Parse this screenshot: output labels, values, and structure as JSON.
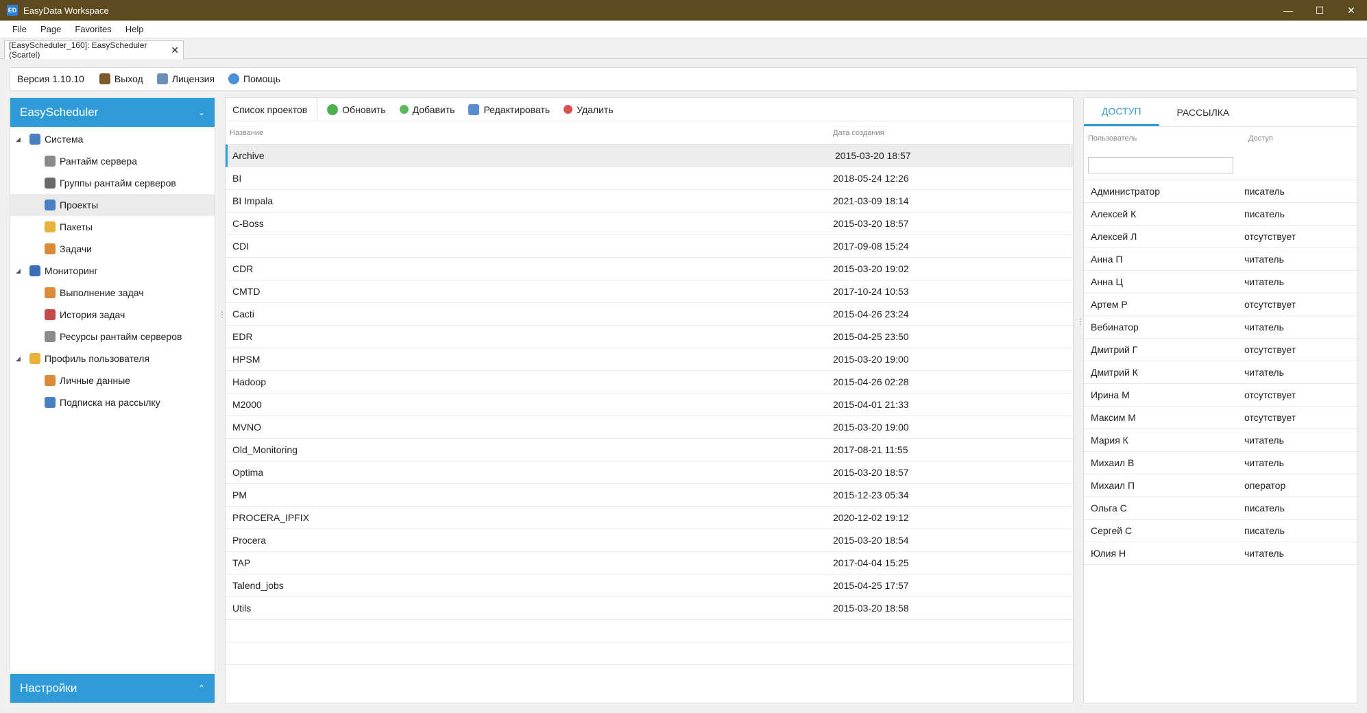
{
  "window": {
    "title": "EasyData Workspace",
    "app_icon_text": "ED"
  },
  "menu": [
    "File",
    "Page",
    "Favorites",
    "Help"
  ],
  "doc_tab": {
    "label": "[EasyScheduler_160]: EasyScheduler (Scartel)",
    "close": "✕"
  },
  "topbar": {
    "version": "Версия 1.10.10",
    "exit": "Выход",
    "license": "Лицензия",
    "help": "Помощь"
  },
  "sidebar": {
    "title": "EasyScheduler",
    "footer": "Настройки",
    "items": [
      {
        "label": "Система",
        "level": 0,
        "icon": "system-icon",
        "color": "#4a7fc1"
      },
      {
        "label": "Рантайм сервера",
        "level": 1,
        "icon": "server-icon",
        "color": "#8a8a8a"
      },
      {
        "label": "Группы рантайм серверов",
        "level": 1,
        "icon": "server-group-icon",
        "color": "#6a6a6a"
      },
      {
        "label": "Проекты",
        "level": 1,
        "icon": "projects-icon",
        "color": "#4a7fc1"
      },
      {
        "label": "Пакеты",
        "level": 1,
        "icon": "package-icon",
        "color": "#e6b23a"
      },
      {
        "label": "Задачи",
        "level": 1,
        "icon": "tasks-icon",
        "color": "#d98b3a"
      },
      {
        "label": "Мониторинг",
        "level": 0,
        "icon": "monitor-icon",
        "color": "#3a6fb8"
      },
      {
        "label": "Выполнение задач",
        "level": 1,
        "icon": "task-run-icon",
        "color": "#d98b3a"
      },
      {
        "label": "История задач",
        "level": 1,
        "icon": "history-chart-icon",
        "color": "#c44b4b"
      },
      {
        "label": "Ресурсы рантайм серверов",
        "level": 1,
        "icon": "resources-icon",
        "color": "#8a8a8a"
      },
      {
        "label": "Профиль пользователя",
        "level": 0,
        "icon": "profile-icon",
        "color": "#e6b23a"
      },
      {
        "label": "Личные данные",
        "level": 1,
        "icon": "person-icon",
        "color": "#d98b3a"
      },
      {
        "label": "Подписка на рассылку",
        "level": 1,
        "icon": "subscription-icon",
        "color": "#4a7fc1"
      }
    ]
  },
  "projects": {
    "toolbar": {
      "title": "Список проектов",
      "refresh": "Обновить",
      "add": "Добавить",
      "edit": "Редактировать",
      "delete": "Удалить"
    },
    "columns": [
      "Название",
      "Дата создания"
    ],
    "rows": [
      [
        "Archive",
        "2015-03-20 18:57"
      ],
      [
        "BI",
        "2018-05-24 12:26"
      ],
      [
        "BI Impala",
        "2021-03-09 18:14"
      ],
      [
        "C-Boss",
        "2015-03-20 18:57"
      ],
      [
        "CDI",
        "2017-09-08 15:24"
      ],
      [
        "CDR",
        "2015-03-20 19:02"
      ],
      [
        "CMTD",
        "2017-10-24 10:53"
      ],
      [
        "Cacti",
        "2015-04-26 23:24"
      ],
      [
        "EDR",
        "2015-04-25 23:50"
      ],
      [
        "HPSM",
        "2015-03-20 19:00"
      ],
      [
        "Hadoop",
        "2015-04-26 02:28"
      ],
      [
        "M2000",
        "2015-04-01 21:33"
      ],
      [
        "MVNO",
        "2015-03-20 19:00"
      ],
      [
        "Old_Monitoring",
        "2017-08-21 11:55"
      ],
      [
        "Optima",
        "2015-03-20 18:57"
      ],
      [
        "PM",
        "2015-12-23 05:34"
      ],
      [
        "PROCERA_IPFIX",
        "2020-12-02 19:12"
      ],
      [
        "Procera",
        "2015-03-20 18:54"
      ],
      [
        "TAP",
        "2017-04-04 15:25"
      ],
      [
        "Talend_jobs",
        "2015-04-25 17:57"
      ],
      [
        "Utils",
        "2015-03-20 18:58"
      ]
    ]
  },
  "access": {
    "tabs": [
      "ДОСТУП",
      "РАССЫЛКА"
    ],
    "columns": [
      "Пользователь",
      "Доступ"
    ],
    "filter_value": "",
    "rows": [
      [
        "Администратор",
        "писатель"
      ],
      [
        "Алексей К",
        "писатель"
      ],
      [
        "Алексей Л",
        "отсутствует"
      ],
      [
        "Анна П",
        "читатель"
      ],
      [
        "Анна Ц",
        "читатель"
      ],
      [
        "Артем Р",
        "отсутствует"
      ],
      [
        "Вебинатор",
        "читатель"
      ],
      [
        "Дмитрий Г",
        "отсутствует"
      ],
      [
        "Дмитрий К",
        "читатель"
      ],
      [
        "Ирина М",
        "отсутствует"
      ],
      [
        "Максим М",
        "отсутствует"
      ],
      [
        "Мария К",
        "читатель"
      ],
      [
        "Михаил В",
        "читатель"
      ],
      [
        "Михаил П",
        "оператор"
      ],
      [
        "Ольга С",
        "писатель"
      ],
      [
        "Сергей С",
        "писатель"
      ],
      [
        "Юлия Н",
        "читатель"
      ]
    ]
  },
  "colors": {
    "accent": "#2e9bd6",
    "titlebar": "#5e4a1f"
  }
}
